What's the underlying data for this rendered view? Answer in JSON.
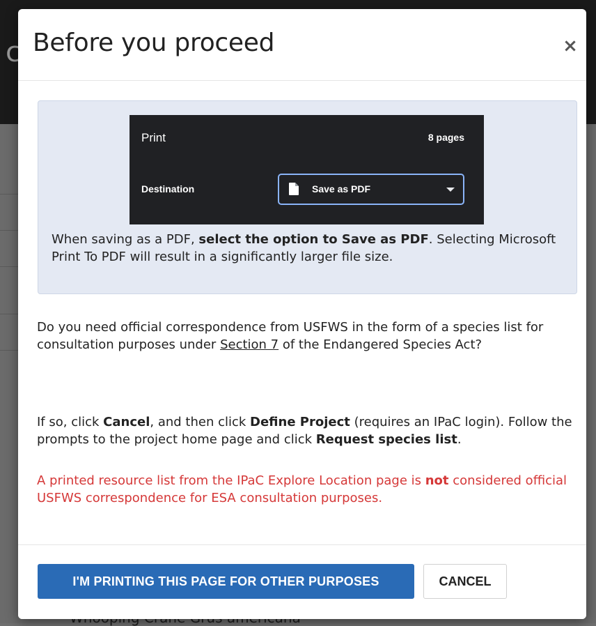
{
  "background": {
    "partial_letter": "c",
    "bottom_text": "Whooping Crane    Grus americana"
  },
  "modal": {
    "title": "Before you proceed",
    "close_icon": "close-icon",
    "close_glyph": "×"
  },
  "print_preview": {
    "title": "Print",
    "pages": "8 pages",
    "destination_label": "Destination",
    "destination_value": "Save as PDF",
    "colors": {
      "panel": "#202124",
      "select_border": "#8ab4f8"
    }
  },
  "info": {
    "text_before": "When saving as a PDF, ",
    "text_bold": "select the option to Save as PDF",
    "text_after": ". Selecting Microsoft Print To PDF will result in a significantly larger file size."
  },
  "para1": {
    "before": "Do you need official correspondence from USFWS in the form of a species list for consultation purposes under ",
    "link": "Section 7",
    "after": " of the Endangered Species Act?"
  },
  "para2": {
    "t1": "If so, click ",
    "b1": "Cancel",
    "t2": ", and then click ",
    "b2": "Define Project",
    "t3": " (requires an IPaC login). Follow the prompts to the project home page and click ",
    "b3": "Request species list",
    "t4": "."
  },
  "warning": {
    "before": "A printed resource list from the IPaC Explore Location page is ",
    "bold": "not",
    "after": " considered official USFWS correspondence for ESA consultation purposes.",
    "color": "#d53838"
  },
  "footer": {
    "primary_label": "I'M PRINTING THIS PAGE FOR OTHER PURPOSES",
    "cancel_label": "CANCEL",
    "primary_color": "#2a6bb6"
  }
}
